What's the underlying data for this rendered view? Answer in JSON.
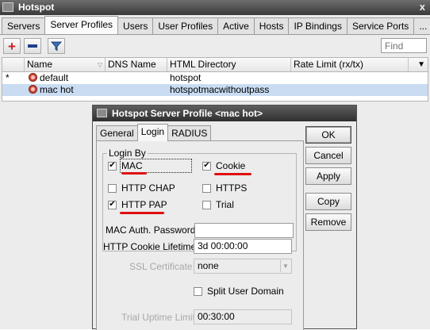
{
  "window": {
    "title": "Hotspot",
    "close": "x"
  },
  "tabs": [
    "Servers",
    "Server Profiles",
    "Users",
    "User Profiles",
    "Active",
    "Hosts",
    "IP Bindings",
    "Service Ports",
    "..."
  ],
  "toolbar": {
    "add": "+",
    "remove": "−",
    "find_placeholder": "Find"
  },
  "table": {
    "columns": [
      "Name",
      "DNS Name",
      "HTML Directory",
      "Rate Limit (rx/tx)"
    ],
    "rows": [
      {
        "marker": "*",
        "name": "default",
        "dns": "",
        "html": "hotspot",
        "rate": ""
      },
      {
        "marker": "",
        "name": "mac hot",
        "dns": "",
        "html": "hotspotmacwithoutpass",
        "rate": ""
      }
    ]
  },
  "dialog": {
    "title": "Hotspot Server Profile <mac hot>",
    "tabs": [
      "General",
      "Login",
      "RADIUS"
    ],
    "login_by": {
      "label": "Login By",
      "mac": {
        "label": "MAC",
        "checked": true
      },
      "cookie": {
        "label": "Cookie",
        "checked": true
      },
      "http_chap": {
        "label": "HTTP CHAP",
        "checked": false
      },
      "https": {
        "label": "HTTPS",
        "checked": false
      },
      "http_pap": {
        "label": "HTTP PAP",
        "checked": true
      },
      "trial": {
        "label": "Trial",
        "checked": false
      }
    },
    "mac_auth_password": {
      "label": "MAC Auth. Password:",
      "value": ""
    },
    "cookie_lifetime": {
      "label": "HTTP Cookie Lifetime:",
      "value": "3d 00:00:00"
    },
    "ssl_certificate": {
      "label": "SSL Certificate",
      "value": "none"
    },
    "split_user_domain": {
      "label": "Split User Domain",
      "checked": false
    },
    "trial_uptime_limit": {
      "label": "Trial Uptime Limit",
      "value": "00:30:00"
    },
    "buttons": {
      "ok": "OK",
      "cancel": "Cancel",
      "apply": "Apply",
      "copy": "Copy",
      "remove": "Remove"
    }
  },
  "colors": {
    "annotation": "#e01010",
    "selection": "#c9dcf2",
    "titlebar": "#3a3a3a"
  }
}
